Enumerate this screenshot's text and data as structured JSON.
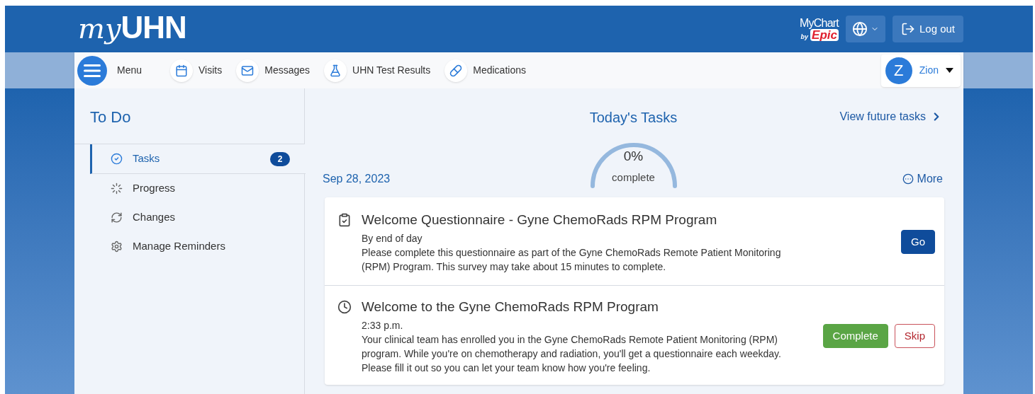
{
  "header": {
    "logo": {
      "script": "my",
      "bold": "UHN"
    },
    "partner_logo": {
      "name": "MyChart",
      "by": "by",
      "brand": "Epic"
    },
    "logout": "Log out"
  },
  "nav": {
    "menu": "Menu",
    "items": [
      {
        "label": "Visits"
      },
      {
        "label": "Messages"
      },
      {
        "label": "UHN Test Results"
      },
      {
        "label": "Medications"
      }
    ],
    "user": {
      "initial": "Z",
      "name": "Zion"
    }
  },
  "sidebar": {
    "title": "To Do",
    "items": [
      {
        "label": "Tasks",
        "selected": true,
        "count": "2"
      },
      {
        "label": "Progress",
        "selected": false
      },
      {
        "label": "Changes",
        "selected": false
      },
      {
        "label": "Manage Reminders",
        "selected": false
      }
    ]
  },
  "main": {
    "title": "Today's Tasks",
    "future_link": "View future tasks",
    "progress": {
      "percent": "0%",
      "caption": "complete"
    },
    "date": "Sep 28, 2023",
    "more": "More",
    "tasks": [
      {
        "kind": "questionnaire",
        "title": "Welcome Questionnaire - Gyne ChemoRads RPM Program",
        "due": "By end of day",
        "description": "Please complete this questionnaire as part of the Gyne ChemoRads Remote Patient Monitoring (RPM) Program. This survey may take about 15 minutes to complete.",
        "actions": [
          {
            "label": "Go",
            "kind": "primary"
          }
        ]
      },
      {
        "kind": "reminder",
        "title": "Welcome to the Gyne ChemoRads RPM Program",
        "due": "2:33 p.m.",
        "description": "Your clinical team has enrolled you in the Gyne ChemoRads Remote Patient Monitoring (RPM) program. While you're on chemotherapy and radiation, you'll get a questionnaire each weekday. Please fill it out so you can let your team know how you're feeling.",
        "actions": [
          {
            "label": "Complete",
            "kind": "success"
          },
          {
            "label": "Skip",
            "kind": "danger"
          }
        ]
      }
    ]
  }
}
